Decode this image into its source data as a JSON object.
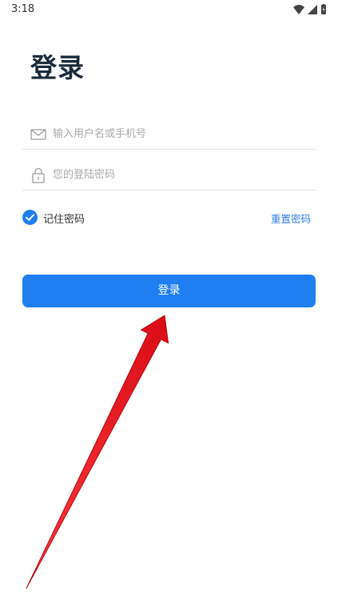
{
  "status_bar": {
    "time": "3:18",
    "icons": [
      "wifi-icon",
      "cellular-signal-icon",
      "battery-icon"
    ]
  },
  "page": {
    "title": "登录"
  },
  "username": {
    "icon": "mail-icon",
    "value": "",
    "placeholder": "输入用户名或手机号"
  },
  "password": {
    "icon": "lock-icon",
    "value": "",
    "placeholder": "您的登陆密码"
  },
  "remember": {
    "checked": true,
    "label": "记住密码"
  },
  "reset": {
    "label": "重置密码"
  },
  "login_button": {
    "label": "登录"
  },
  "annotation": {
    "icon": "red-arrow-icon",
    "color": "#e8141c"
  },
  "colors": {
    "accent": "#1f7ff0",
    "title": "#1c2b3a",
    "link": "#2f7fe0"
  }
}
